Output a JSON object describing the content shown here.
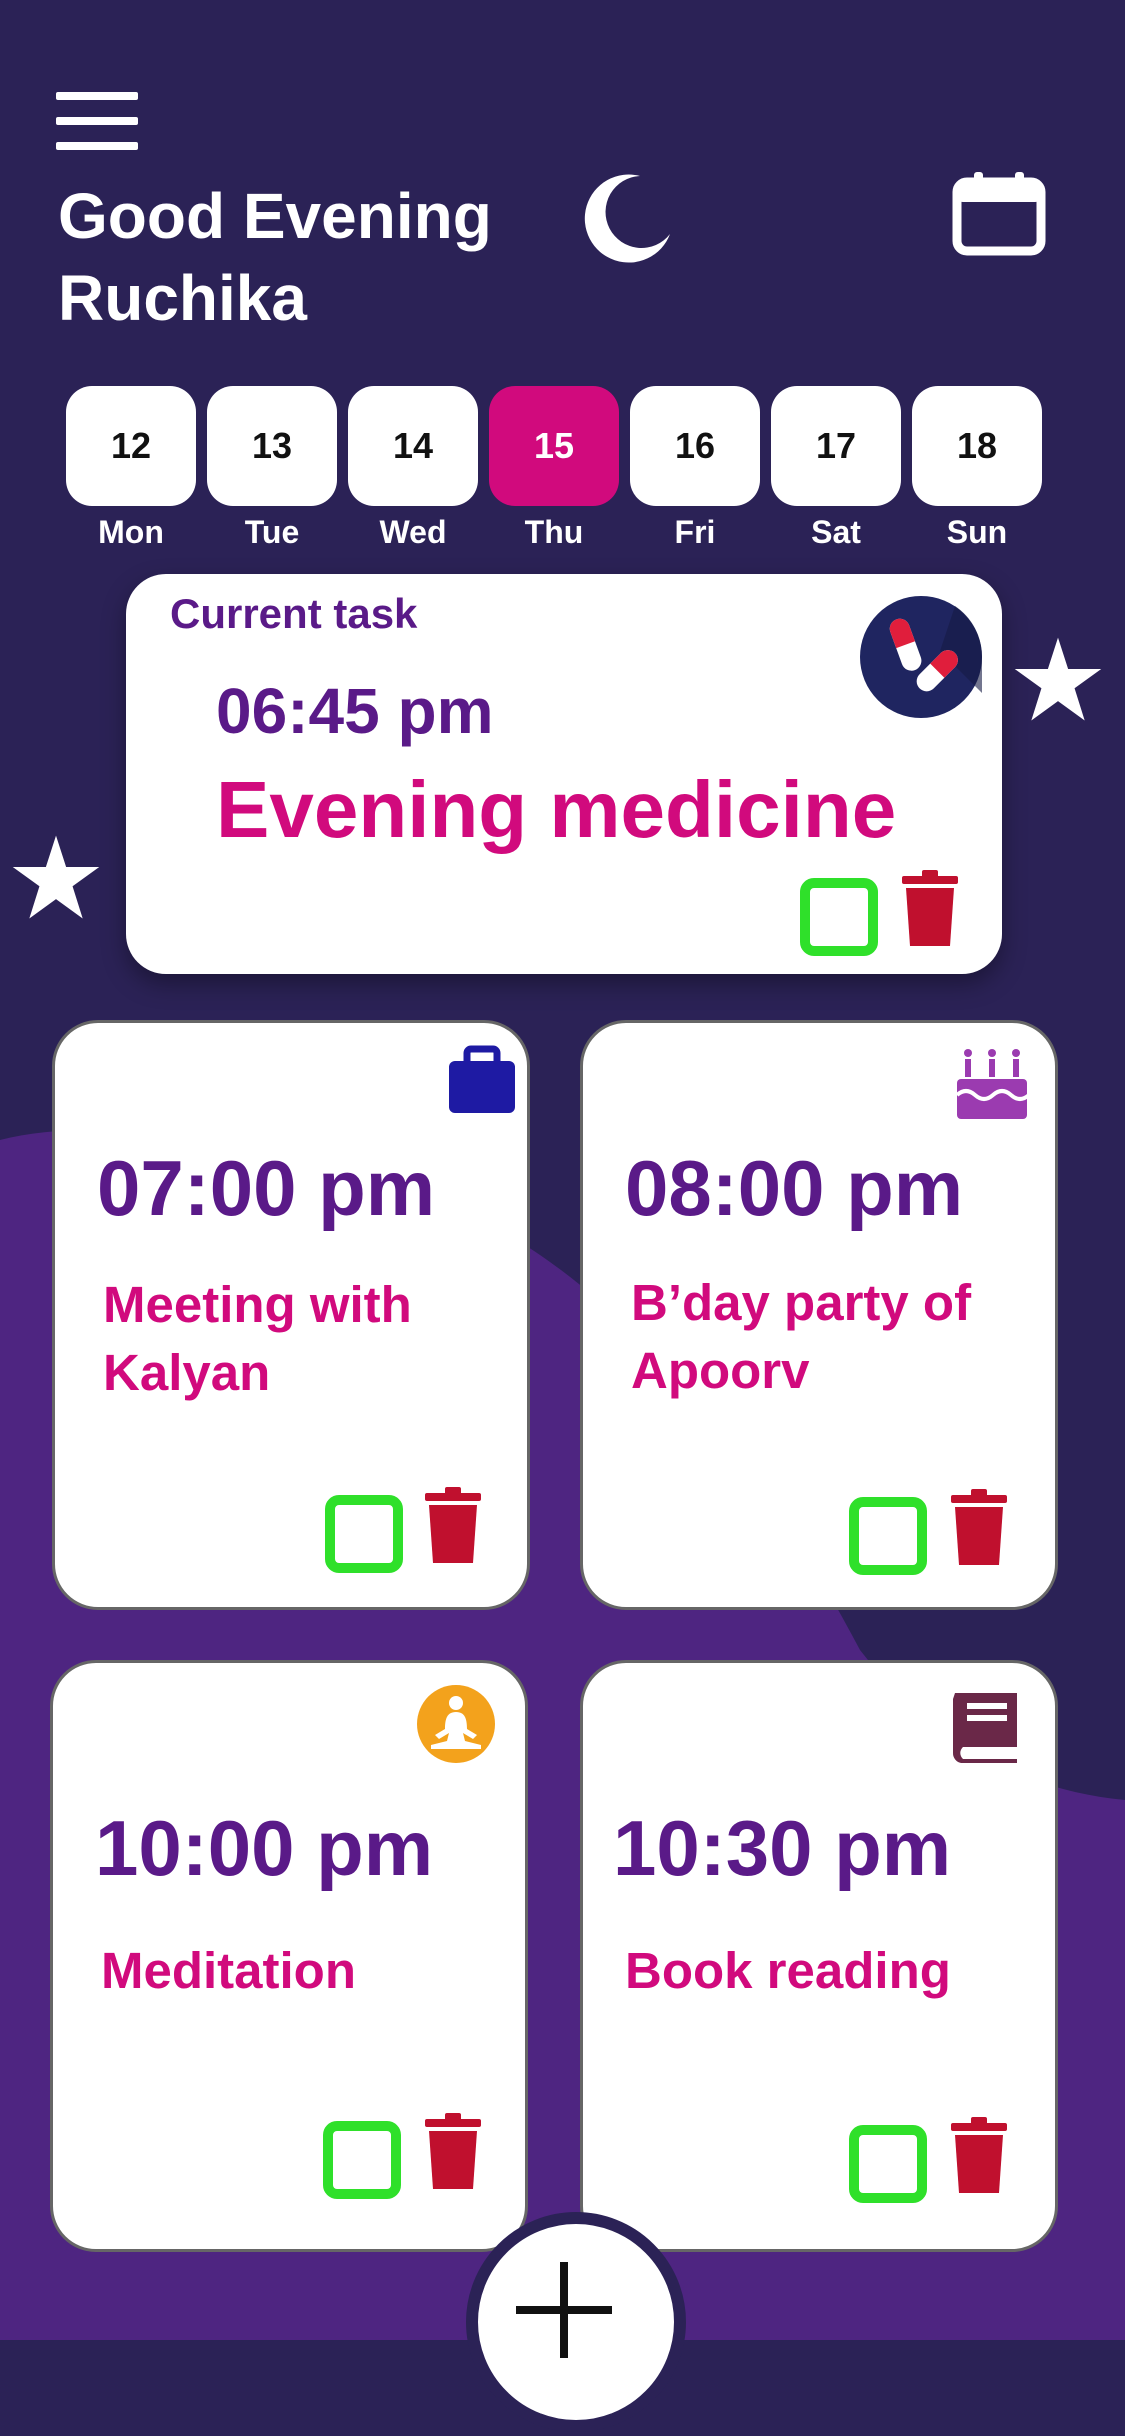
{
  "header": {
    "greeting_line1": "Good Evening",
    "greeting_line2": "Ruchika"
  },
  "days": [
    {
      "num": "12",
      "name": "Mon",
      "active": false
    },
    {
      "num": "13",
      "name": "Tue",
      "active": false
    },
    {
      "num": "14",
      "name": "Wed",
      "active": false
    },
    {
      "num": "15",
      "name": "Thu",
      "active": true
    },
    {
      "num": "16",
      "name": "Fri",
      "active": false
    },
    {
      "num": "17",
      "name": "Sat",
      "active": false
    },
    {
      "num": "18",
      "name": "Sun",
      "active": false
    }
  ],
  "current_task": {
    "title": "Current task",
    "time": "06:45 pm",
    "task": "Evening medicine",
    "icon": "medicine-pill-icon"
  },
  "tasks": [
    {
      "time": "07:00 pm",
      "task_line1": "Meeting with",
      "task_line2": "Kalyan",
      "icon": "briefcase-icon"
    },
    {
      "time": "08:00 pm",
      "task_line1": "B’day party of",
      "task_line2": "Apoorv",
      "icon": "birthday-cake-icon"
    },
    {
      "time": "10:00 pm",
      "task_line1": "Meditation",
      "task_line2": "",
      "icon": "meditation-icon"
    },
    {
      "time": "10:30 pm",
      "task_line1": "Book reading",
      "task_line2": "",
      "icon": "book-icon"
    }
  ],
  "colors": {
    "background": "#2b2256",
    "wave": "#4e2581",
    "accent_pink": "#d10a7d",
    "time_purple": "#5a1a88",
    "check_green": "#2fe02a",
    "trash_red": "#c0102e"
  }
}
